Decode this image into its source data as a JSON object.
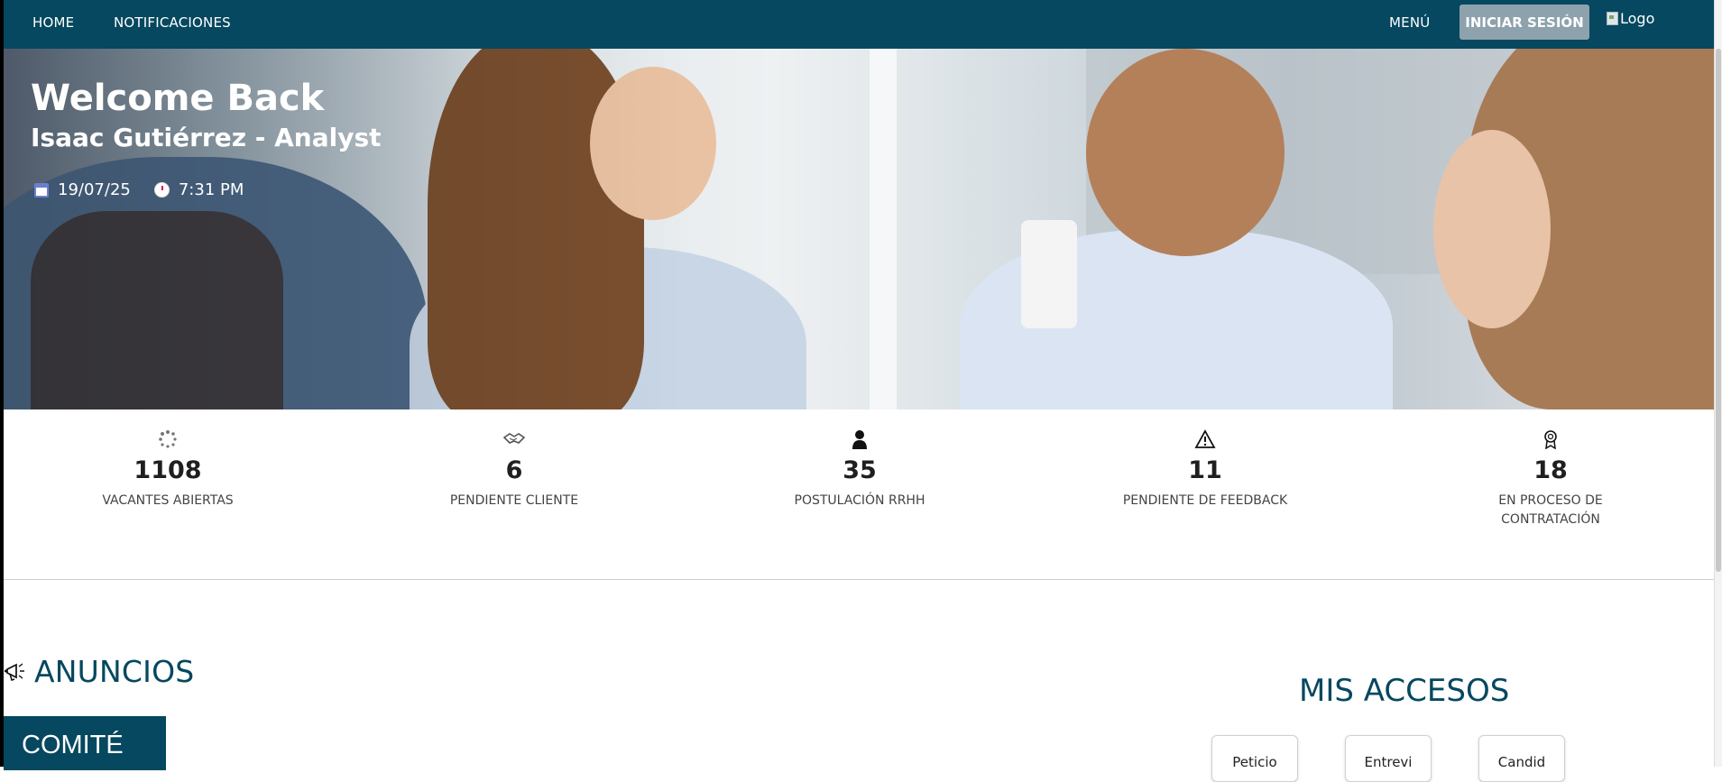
{
  "nav": {
    "home": "HOME",
    "notifications": "NOTIFICACIONES",
    "menu": "MENÚ",
    "login": "INICIAR SESIÓN",
    "logo_alt": "Logo"
  },
  "hero": {
    "title": "Welcome Back",
    "subtitle": "Isaac Gutiérrez - Analyst",
    "date": "19/07/25",
    "time": "7:31 PM"
  },
  "stats": [
    {
      "icon": "spinner-icon",
      "value": "1108",
      "label": "VACANTES ABIERTAS"
    },
    {
      "icon": "handshake-icon",
      "value": "6",
      "label": "PENDIENTE CLIENTE"
    },
    {
      "icon": "user-icon",
      "value": "35",
      "label": "POSTULACIÓN RRHH"
    },
    {
      "icon": "warning-icon",
      "value": "11",
      "label": "PENDIENTE DE FEEDBACK"
    },
    {
      "icon": "award-icon",
      "value": "18",
      "label": "EN PROCESO DE CONTRATACIÓN"
    }
  ],
  "announcements": {
    "title": "ANUNCIOS",
    "first_card": "COMITÉ"
  },
  "access": {
    "title": "MIS ACCESOS",
    "cards": [
      "Peticio",
      "Entrevi",
      "Candid"
    ]
  },
  "colors": {
    "primary": "#05485f",
    "button_muted": "#8da2ad"
  }
}
